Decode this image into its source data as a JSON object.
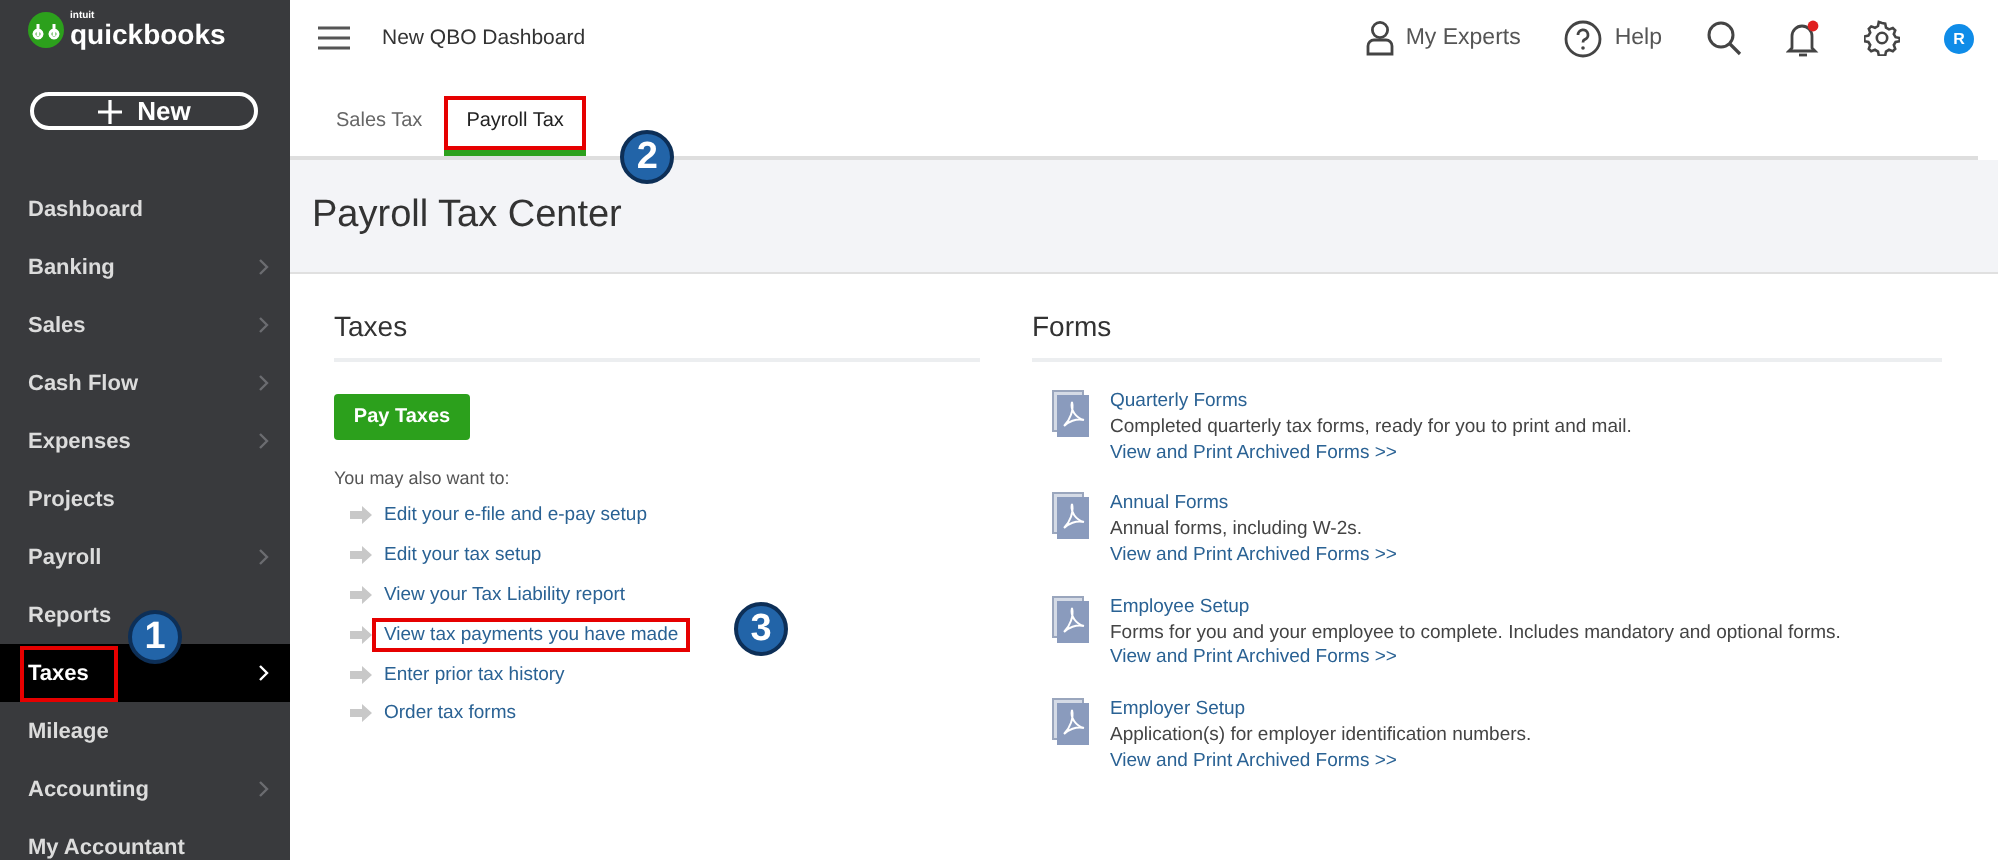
{
  "sidebar": {
    "logo_brand": "intuit",
    "logo": "quickbooks",
    "new_button": "New",
    "items": [
      {
        "label": "Dashboard",
        "selected": false,
        "has_submenu": false,
        "highlighted": false
      },
      {
        "label": "Banking",
        "selected": false,
        "has_submenu": true,
        "highlighted": false
      },
      {
        "label": "Sales",
        "selected": false,
        "has_submenu": true,
        "highlighted": false
      },
      {
        "label": "Cash Flow",
        "selected": false,
        "has_submenu": true,
        "highlighted": false
      },
      {
        "label": "Expenses",
        "selected": false,
        "has_submenu": true,
        "highlighted": false
      },
      {
        "label": "Projects",
        "selected": false,
        "has_submenu": false,
        "highlighted": false
      },
      {
        "label": "Payroll",
        "selected": false,
        "has_submenu": true,
        "highlighted": false
      },
      {
        "label": "Reports",
        "selected": false,
        "has_submenu": false,
        "highlighted": false
      },
      {
        "label": "Taxes",
        "selected": true,
        "has_submenu": true,
        "highlighted": true,
        "callout": "1"
      },
      {
        "label": "Mileage",
        "selected": false,
        "has_submenu": false,
        "highlighted": false
      },
      {
        "label": "Accounting",
        "selected": false,
        "has_submenu": true,
        "highlighted": false
      },
      {
        "label": "My Accountant",
        "selected": false,
        "has_submenu": false,
        "highlighted": false
      }
    ]
  },
  "topbar": {
    "title": "New QBO Dashboard",
    "experts": "My Experts",
    "help": "Help",
    "avatar": "R",
    "notification": true
  },
  "tabs": [
    {
      "label": "Sales Tax",
      "selected": false,
      "highlighted": false
    },
    {
      "label": "Payroll Tax",
      "selected": true,
      "highlighted": true,
      "callout": "2"
    }
  ],
  "page_title": "Payroll Tax Center",
  "taxes": {
    "heading": "Taxes",
    "button": "Pay Taxes",
    "intro": "You may also want to:",
    "links": [
      {
        "label": "Edit your e-file and e-pay setup",
        "highlighted": false
      },
      {
        "label": "Edit your tax setup",
        "highlighted": false
      },
      {
        "label": "View your Tax Liability report",
        "highlighted": false
      },
      {
        "label": "View tax payments you have made",
        "highlighted": true,
        "callout": "3"
      },
      {
        "label": "Enter prior tax history",
        "highlighted": false
      },
      {
        "label": "Order tax forms",
        "highlighted": false
      }
    ]
  },
  "forms": {
    "heading": "Forms",
    "items": [
      {
        "title": "Quarterly Forms",
        "description": "Completed quarterly tax forms, ready for you to print and mail.",
        "link": "View and Print Archived Forms >>"
      },
      {
        "title": "Annual Forms",
        "description": "Annual forms, including W-2s.",
        "link": "View and Print Archived Forms >>"
      },
      {
        "title": "Employee Setup",
        "description": "Forms for you and your employee to complete. Includes mandatory and optional forms.",
        "link": "View and Print Archived Forms >>"
      },
      {
        "title": "Employer Setup",
        "description": "Application(s) for employer identification numbers.",
        "link": "View and Print Archived Forms >>"
      }
    ]
  }
}
